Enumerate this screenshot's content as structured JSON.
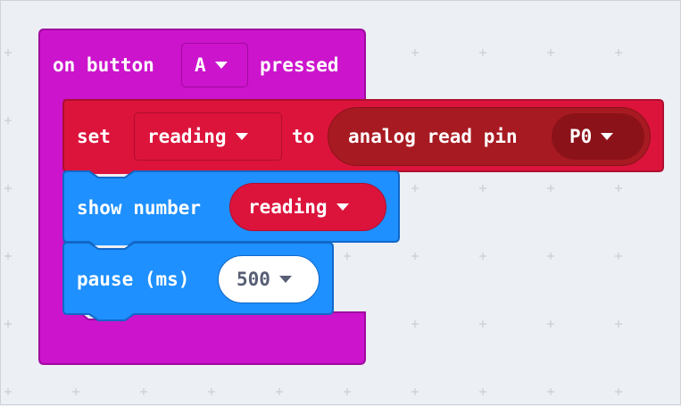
{
  "colors": {
    "event_block": "#cc14cc",
    "event_border": "#a00aa0",
    "variable_block": "#dc143c",
    "variable_border": "#b00e2f",
    "pins_reporter": "#a81a22",
    "pins_dropdown": "#8c1219",
    "basic_block": "#1e90ff",
    "basic_border": "#1268c8",
    "workspace_bg": "#eceff3",
    "grid_plus": "#c9ced6"
  },
  "event_block": {
    "on_label": "on button",
    "button_value": "A",
    "pressed_label": "pressed"
  },
  "set_block": {
    "set_label": "set",
    "variable": "reading",
    "to_label": "to",
    "reporter_label": "analog read pin",
    "pin_value": "P0"
  },
  "show_block": {
    "label": "show number",
    "variable": "reading"
  },
  "pause_block": {
    "label": "pause (ms)",
    "value": "500"
  },
  "icons": {
    "dropdown": "chevron-down-icon"
  }
}
